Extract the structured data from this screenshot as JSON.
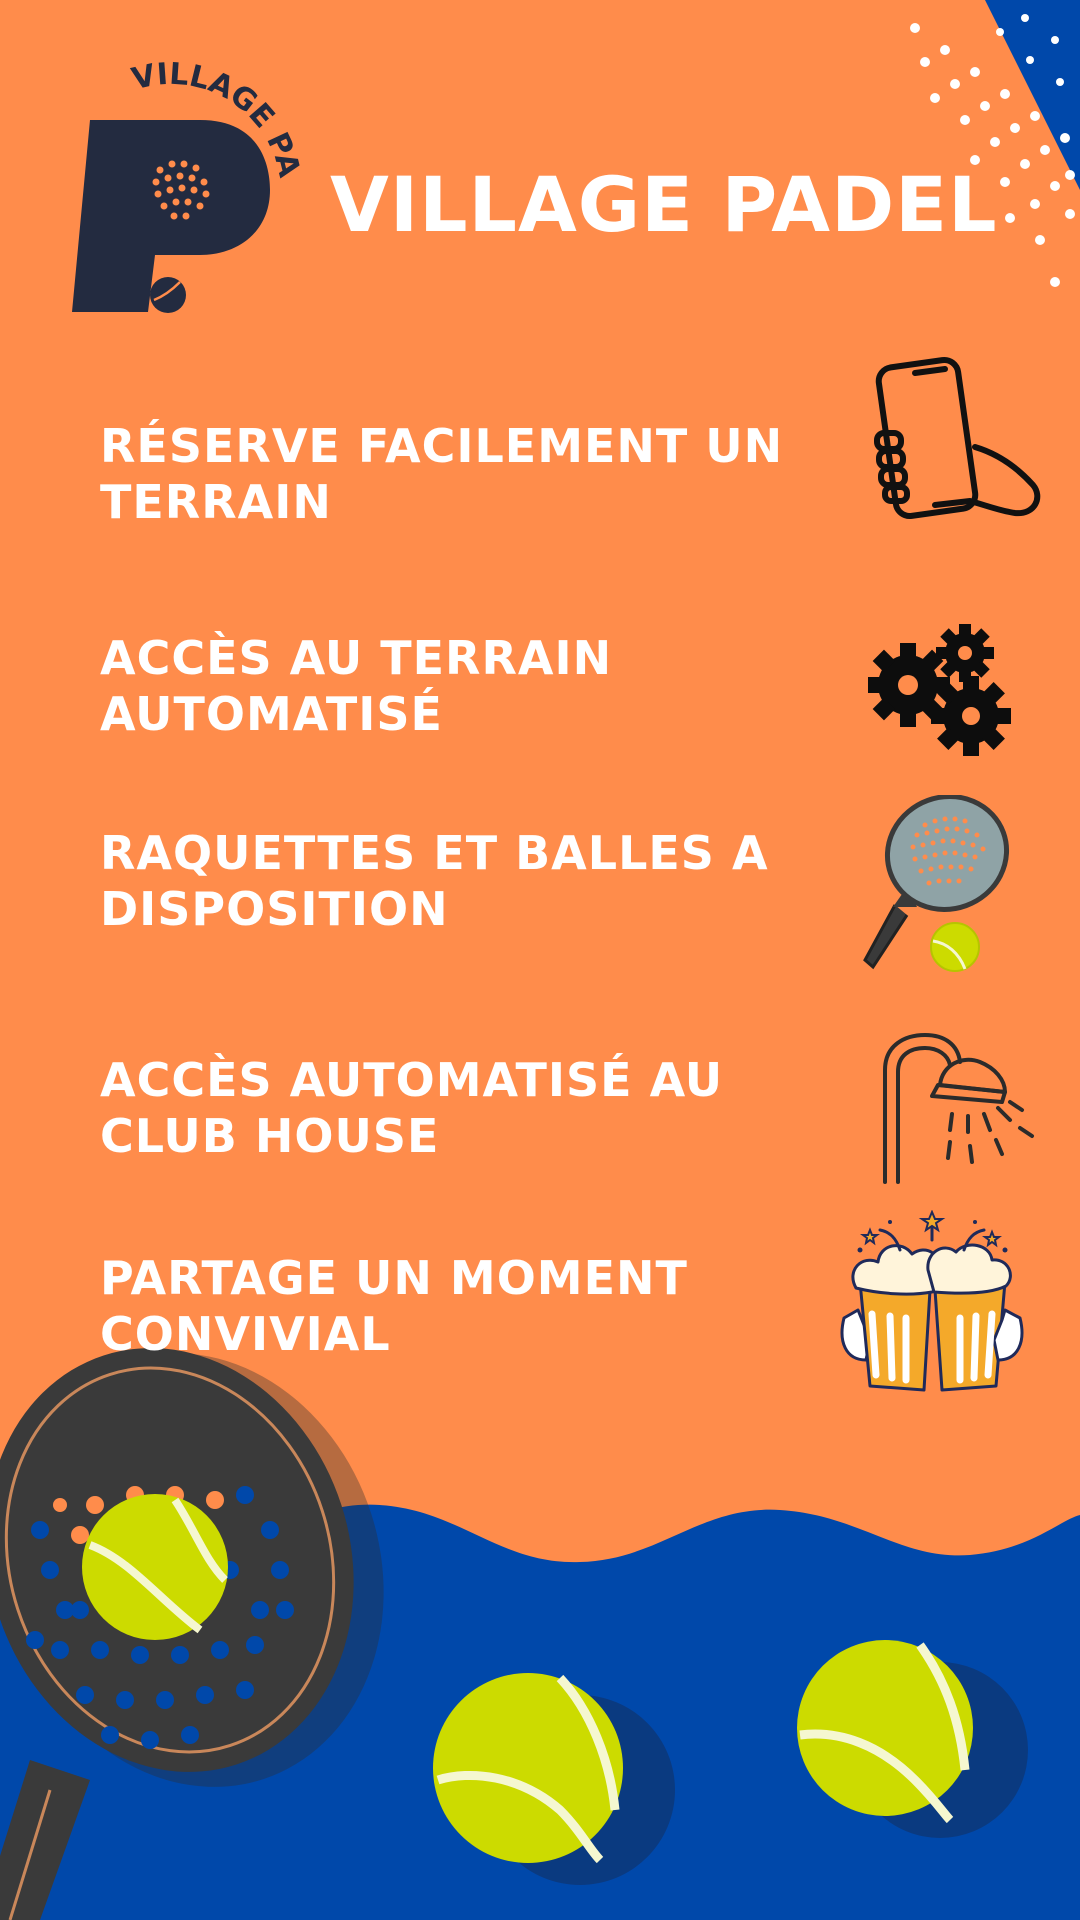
{
  "brand": {
    "title": "VILLAGE PADEL",
    "logo_text": "VILLAGE PADEL",
    "logo_letter": "P"
  },
  "features": [
    {
      "line1": "RÉSERVE FACILEMENT UN",
      "line2": "TERRAIN",
      "icon": "phone-in-hand-icon"
    },
    {
      "line1": "ACCÈS AU TERRAIN",
      "line2": "AUTOMATISÉ",
      "icon": "gears-icon"
    },
    {
      "line1": "RAQUETTES ET BALLES A",
      "line2": "DISPOSITION",
      "icon": "padel-racket-ball-icon"
    },
    {
      "line1": "ACCÈS AUTOMATISÉ AU",
      "line2": "CLUB HOUSE",
      "icon": "shower-icon"
    },
    {
      "line1": "PARTAGE UN MOMENT",
      "line2": "CONVIVIAL",
      "icon": "beer-toast-icon"
    }
  ],
  "colors": {
    "background": "#FF8C4B",
    "wave": "#0048AA",
    "text": "#FFFFFF",
    "logo": "#232B40",
    "ball": "#CCDB00",
    "racket": "#3A3A3A"
  }
}
